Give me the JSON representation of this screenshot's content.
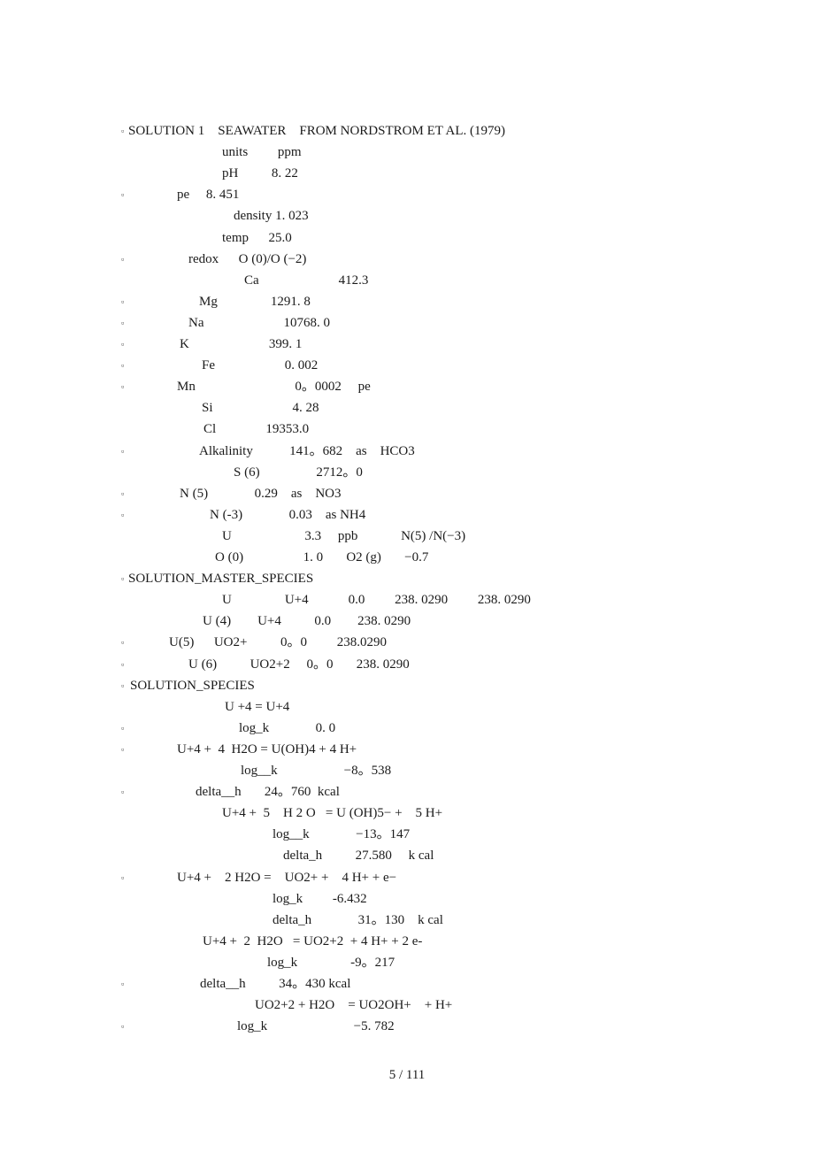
{
  "document": {
    "bullet_glyph": "▫",
    "lines": [
      {
        "text": "SOLUTION 1    SEAWATER    FROM NORDSTROM ET AL. (1979)",
        "bullet": true
      },
      {
        "text": "units         ppm",
        "bullet": false
      },
      {
        "text": "pH          8. 22",
        "bullet": false
      },
      {
        "text": "pe     8. 451",
        "bullet": true
      },
      {
        "text": "density 1. 023",
        "bullet": false
      },
      {
        "text": "temp      25.0",
        "bullet": false
      },
      {
        "text": "redox      O (0)/O (−2)",
        "bullet": true
      },
      {
        "text": "Ca                        412.3",
        "bullet": false
      },
      {
        "text": "Mg                1291. 8",
        "bullet": true
      },
      {
        "text": "Na                        10768. 0",
        "bullet": true
      },
      {
        "text": "K                        399. 1",
        "bullet": true
      },
      {
        "text": "Fe                     0. 002",
        "bullet": true
      },
      {
        "text": "Mn                              0。0002     pe",
        "bullet": true
      },
      {
        "text": "Si                        4. 28",
        "bullet": false
      },
      {
        "text": "Cl               19353.0",
        "bullet": false
      },
      {
        "text": "Alkalinity           141。682    as    HCO3",
        "bullet": true
      },
      {
        "text": "S (6)                 2712。0",
        "bullet": false
      },
      {
        "text": "N (5)              0.29    as    NO3",
        "bullet": true
      },
      {
        "text": "N (-3)              0.03    as NH4",
        "bullet": true
      },
      {
        "text": "U                      3.3     ppb             N(5) /N(−3)",
        "bullet": false
      },
      {
        "text": "O (0)                  1. 0       O2 (g)       −0.7",
        "bullet": false
      },
      {
        "text": "SOLUTION_MASTER_SPECIES",
        "bullet": true
      },
      {
        "text": "U                U+4            0.0         238. 0290         238. 0290",
        "bullet": false
      },
      {
        "text": "U (4)        U+4          0.0        238. 0290",
        "bullet": false
      },
      {
        "text": "U(5)      UO2+          0。0         238.0290",
        "bullet": true
      },
      {
        "text": "U (6)          UO2+2     0。0       238. 0290",
        "bullet": true
      },
      {
        "text": "SOLUTION_SPECIES",
        "bullet": true
      },
      {
        "text": "U +4 = U+4",
        "bullet": false
      },
      {
        "text": "log_k              0. 0",
        "bullet": true
      },
      {
        "text": "U+4 +  4  H2O = U(OH)4 + 4 H+",
        "bullet": true
      },
      {
        "text": "log__k                    −8。538",
        "bullet": false
      },
      {
        "text": "delta__h       24。760  kcal",
        "bullet": true
      },
      {
        "text": "U+4 +  5    H 2 O   = U (OH)5− +    5 H+",
        "bullet": false
      },
      {
        "text": "log__k              −13。147",
        "bullet": false
      },
      {
        "text": "delta_h          27.580     k cal",
        "bullet": false
      },
      {
        "text": "U+4 +    2 H2O =    UO2+ +    4 H+ + e−",
        "bullet": true
      },
      {
        "text": "log_k         -6.432",
        "bullet": false
      },
      {
        "text": "delta_h              31。130    k cal",
        "bullet": false
      },
      {
        "text": "U+4 +  2  H2O   = UO2+2  + 4 H+ + 2 e-",
        "bullet": false
      },
      {
        "text": "log_k                -9。217",
        "bullet": false
      },
      {
        "text": "delta__h          34。430 kcal",
        "bullet": true
      },
      {
        "text": "UO2+2 + H2O    = UO2OH+    + H+",
        "bullet": false
      },
      {
        "text": "log_k                          −5. 782",
        "bullet": true
      }
    ],
    "page_number": "5 / 111"
  }
}
